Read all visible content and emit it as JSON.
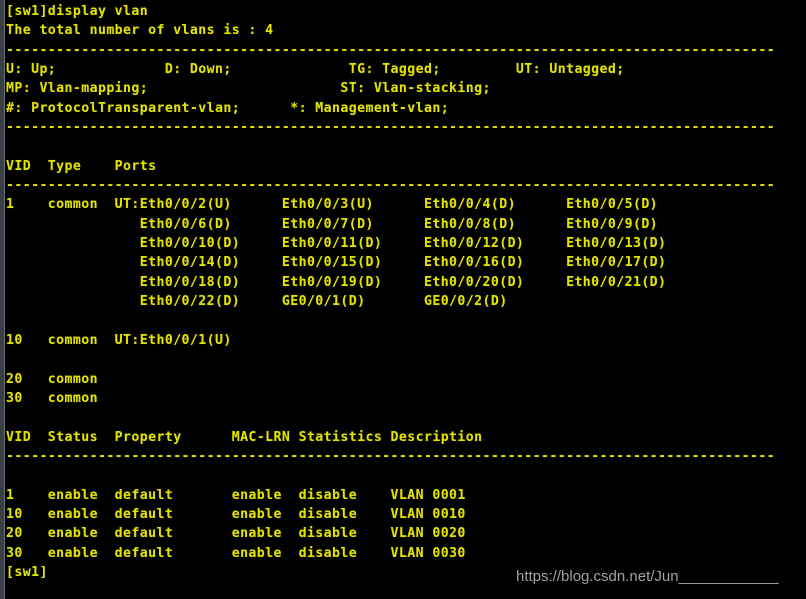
{
  "terminal": {
    "window_title": "display vlan",
    "foreground_color": "#e3e300",
    "background_color": "#000000",
    "prompt": "[sw1]",
    "command": "display vlan",
    "summary_line": "The total number of vlans is : 4",
    "total_vlans": 4,
    "separator": "--------------------------------------------------------------------------------------------",
    "legend": {
      "line1": "U: Up;             D: Down;              TG: Tagged;         UT: Untagged;",
      "line2": "MP: Vlan-mapping;                       ST: Vlan-stacking;",
      "line3": "#: ProtocolTransparent-vlan;      *: Management-vlan;"
    },
    "ports_table": {
      "header": "VID  Type    Ports",
      "rows": [
        "1    common  UT:Eth0/0/2(U)      Eth0/0/3(U)      Eth0/0/4(D)      Eth0/0/5(D)",
        "                Eth0/0/6(D)      Eth0/0/7(D)      Eth0/0/8(D)      Eth0/0/9(D)",
        "                Eth0/0/10(D)     Eth0/0/11(D)     Eth0/0/12(D)     Eth0/0/13(D)",
        "                Eth0/0/14(D)     Eth0/0/15(D)     Eth0/0/16(D)     Eth0/0/17(D)",
        "                Eth0/0/18(D)     Eth0/0/19(D)     Eth0/0/20(D)     Eth0/0/21(D)",
        "                Eth0/0/22(D)     GE0/0/1(D)       GE0/0/2(D)",
        "",
        "10   common  UT:Eth0/0/1(U)",
        "",
        "20   common",
        "30   common"
      ]
    },
    "status_table": {
      "header": "VID  Status  Property      MAC-LRN Statistics Description",
      "rows": [
        "1    enable  default       enable  disable    VLAN 0001",
        "10   enable  default       enable  disable    VLAN 0010",
        "20   enable  default       enable  disable    VLAN 0020",
        "30   enable  default       enable  disable    VLAN 0030"
      ]
    },
    "final_prompt": "[sw1]"
  },
  "watermark": {
    "text": "https://blog.csdn.net/Jun____________",
    "color": "#a2a2a2"
  }
}
